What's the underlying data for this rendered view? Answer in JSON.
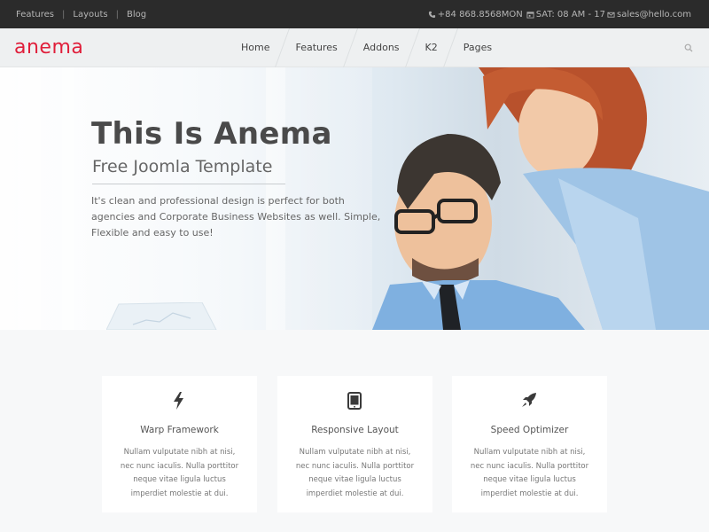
{
  "topbar": {
    "links": [
      "Features",
      "Layouts",
      "Blog"
    ],
    "phone": "+84 868.8568MON",
    "hours": "SAT: 08 AM - 17",
    "email": "sales@hello.com"
  },
  "nav": {
    "logo": "anema",
    "items": [
      "Home",
      "Features",
      "Addons",
      "K2",
      "Pages"
    ]
  },
  "hero": {
    "title": "This Is Anema",
    "subtitle": "Free Joomla Template",
    "text": "It's clean and professional design is perfect for both agencies and Corporate Business Websites as well. Simple, Flexible and easy to use!"
  },
  "features": [
    {
      "icon": "bolt-icon",
      "title": "Warp Framework",
      "text": "Nullam vulputate nibh at nisi, nec nunc iaculis. Nulla porttitor neque vitae ligula luctus imperdiet molestie at dui."
    },
    {
      "icon": "tablet-icon",
      "title": "Responsive Layout",
      "text": "Nullam vulputate nibh at nisi, nec nunc iaculis. Nulla porttitor neque vitae ligula luctus imperdiet molestie at dui."
    },
    {
      "icon": "rocket-icon",
      "title": "Speed Optimizer",
      "text": "Nullam vulputate nibh at nisi, nec nunc iaculis. Nulla porttitor neque vitae ligula luctus imperdiet molestie at dui."
    }
  ],
  "colors": {
    "brand": "#e01e3a",
    "topbar": "#2b2b2b",
    "nav_bg": "#eef0f1"
  }
}
